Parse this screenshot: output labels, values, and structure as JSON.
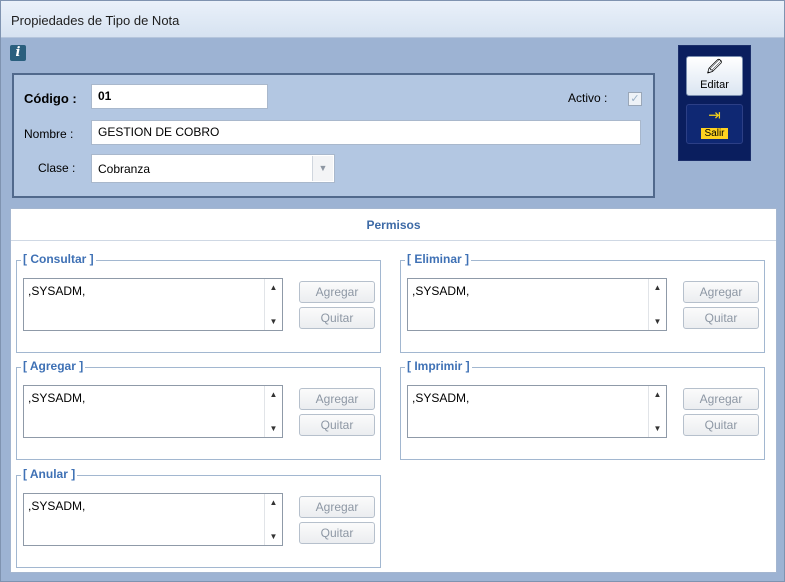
{
  "window": {
    "title": "Propiedades de Tipo de Nota"
  },
  "form": {
    "codigo_label": "Código :",
    "codigo_value": "01",
    "activo_label": "Activo :",
    "activo_checked": true,
    "nombre_label": "Nombre :",
    "nombre_value": "GESTION DE COBRO",
    "clase_label": "Clase :",
    "clase_value": "Cobranza"
  },
  "toolbar": {
    "edit_label": "Editar",
    "exit_label": "Salir"
  },
  "permisos": {
    "title": "Permisos",
    "groups": [
      {
        "title": "[ Consultar ]",
        "list_text": ",SYSADM,",
        "add_label": "Agregar",
        "remove_label": "Quitar"
      },
      {
        "title": "[ Eliminar ]",
        "list_text": ",SYSADM,",
        "add_label": "Agregar",
        "remove_label": "Quitar"
      },
      {
        "title": "[ Agregar ]",
        "list_text": ",SYSADM,",
        "add_label": "Agregar",
        "remove_label": "Quitar"
      },
      {
        "title": "[ Imprimir ]",
        "list_text": ",SYSADM,",
        "add_label": "Agregar",
        "remove_label": "Quitar"
      },
      {
        "title": "[ Anular ]",
        "list_text": ",SYSADM,",
        "add_label": "Agregar",
        "remove_label": "Quitar"
      }
    ]
  }
}
